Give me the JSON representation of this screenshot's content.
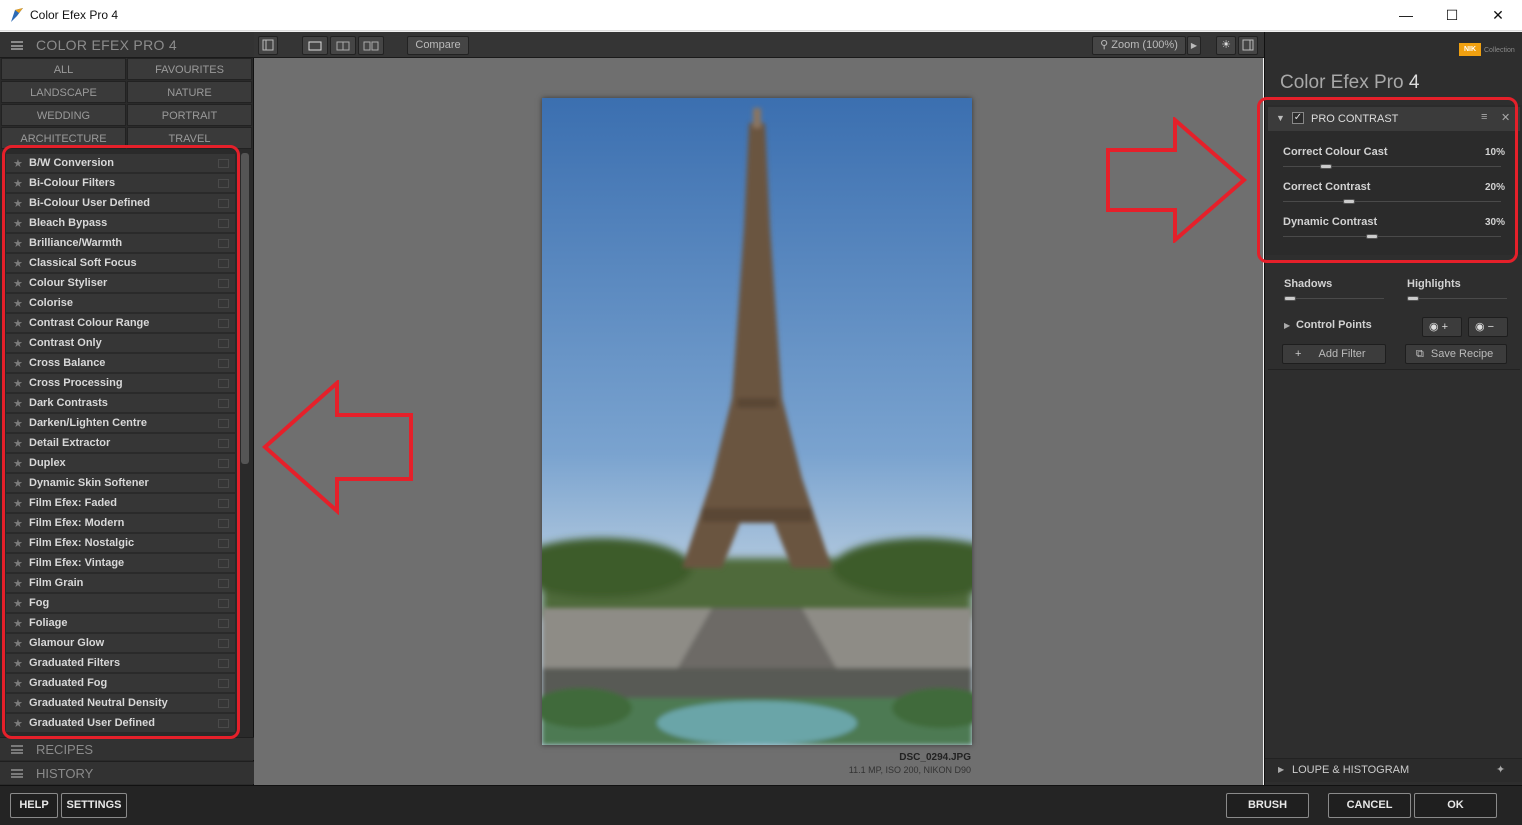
{
  "window": {
    "title": "Color Efex Pro 4",
    "controls": {
      "minimize": "—",
      "maximize": "☐",
      "close": "✕"
    }
  },
  "left_panel": {
    "header": "COLOR EFEX PRO 4",
    "categories": [
      "ALL",
      "FAVOURITES",
      "LANDSCAPE",
      "NATURE",
      "WEDDING",
      "PORTRAIT",
      "ARCHITECTURE",
      "TRAVEL"
    ],
    "filters": [
      "B/W Conversion",
      "Bi-Colour Filters",
      "Bi-Colour User Defined",
      "Bleach Bypass",
      "Brilliance/Warmth",
      "Classical Soft Focus",
      "Colour Styliser",
      "Colorise",
      "Contrast Colour Range",
      "Contrast Only",
      "Cross Balance",
      "Cross Processing",
      "Dark Contrasts",
      "Darken/Lighten Centre",
      "Detail Extractor",
      "Duplex",
      "Dynamic Skin Softener",
      "Film Efex: Faded",
      "Film Efex: Modern",
      "Film Efex: Nostalgic",
      "Film Efex: Vintage",
      "Film Grain",
      "Fog",
      "Foliage",
      "Glamour Glow",
      "Graduated Filters",
      "Graduated Fog",
      "Graduated Neutral Density",
      "Graduated User Defined"
    ],
    "sections": {
      "recipes": "RECIPES",
      "history": "HISTORY"
    }
  },
  "toolbar": {
    "compare": "Compare",
    "zoom": "Zoom (100%)"
  },
  "preview": {
    "filename": "DSC_0294.JPG",
    "info": "11.1 MP, ISO 200, NIKON D90"
  },
  "right_panel": {
    "brand": {
      "badge": "NIK",
      "collection": "Collection"
    },
    "title": "Color Efex Pro",
    "version": "4",
    "filter_name": "PRO CONTRAST",
    "sliders": [
      {
        "label": "Correct Colour Cast",
        "value": "10%",
        "level": 0.1
      },
      {
        "label": "Correct Contrast",
        "value": "20%",
        "level": 0.2
      },
      {
        "label": "Dynamic Contrast",
        "value": "30%",
        "level": 0.3
      }
    ],
    "shadows": {
      "label": "Shadows",
      "level": 0.0
    },
    "highlights": {
      "label": "Highlights",
      "level": 0.0
    },
    "control_points": "Control Points",
    "add_filter": "Add Filter",
    "save_recipe": "Save Recipe",
    "loupe": "LOUPE & HISTOGRAM"
  },
  "bottom_bar": {
    "help": "HELP",
    "settings": "SETTINGS",
    "brush": "BRUSH",
    "cancel": "CANCEL",
    "ok": "OK"
  },
  "colors": {
    "annotation_red": "#e5202a",
    "nik_orange": "#f0a010"
  }
}
